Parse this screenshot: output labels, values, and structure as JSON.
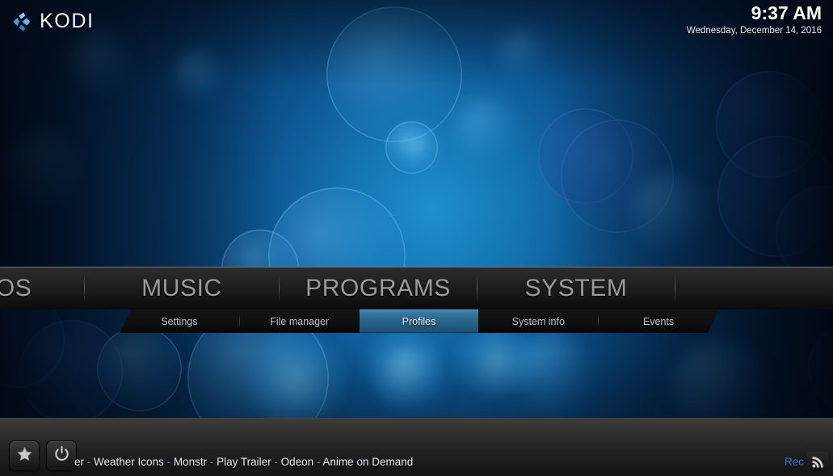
{
  "header": {
    "logo_icon": "kodi-logo-icon",
    "logo_text": "KODI",
    "time": "9:37 AM",
    "date": "Wednesday, December 14, 2016"
  },
  "main_nav": {
    "items": [
      {
        "label": "DEOS",
        "full_label": "VIDEOS",
        "clipped": true
      },
      {
        "label": "MUSIC",
        "clipped": false
      },
      {
        "label": "PROGRAMS",
        "clipped": false
      },
      {
        "label": "SYSTEM",
        "clipped": false
      }
    ]
  },
  "sub_nav": {
    "items": [
      {
        "label": "Settings",
        "selected": false
      },
      {
        "label": "File manager",
        "selected": false
      },
      {
        "label": "Profiles",
        "selected": true
      },
      {
        "label": "System info",
        "selected": false
      },
      {
        "label": "Events",
        "selected": false
      }
    ]
  },
  "bottom_bar": {
    "favourites_icon": "star-icon",
    "power_icon": "power-icon",
    "rss_icon": "rss-feed-icon",
    "ticker": {
      "segments": [
        "er",
        "Weather Icons",
        "Monstr",
        "Play Trailer",
        "Odeon",
        "Anime on Demand"
      ],
      "separator": " - ",
      "tail_text": "Rec"
    }
  },
  "colors": {
    "accent_blue": "#2e6f96",
    "nav_text": "#9b9b9b",
    "sub_text": "#c3c7cb",
    "selected_text": "#eef6fb",
    "ticker_tail": "#2f7fd4",
    "bar_dark": "#151515",
    "bottom_bar": "#302f2e"
  }
}
